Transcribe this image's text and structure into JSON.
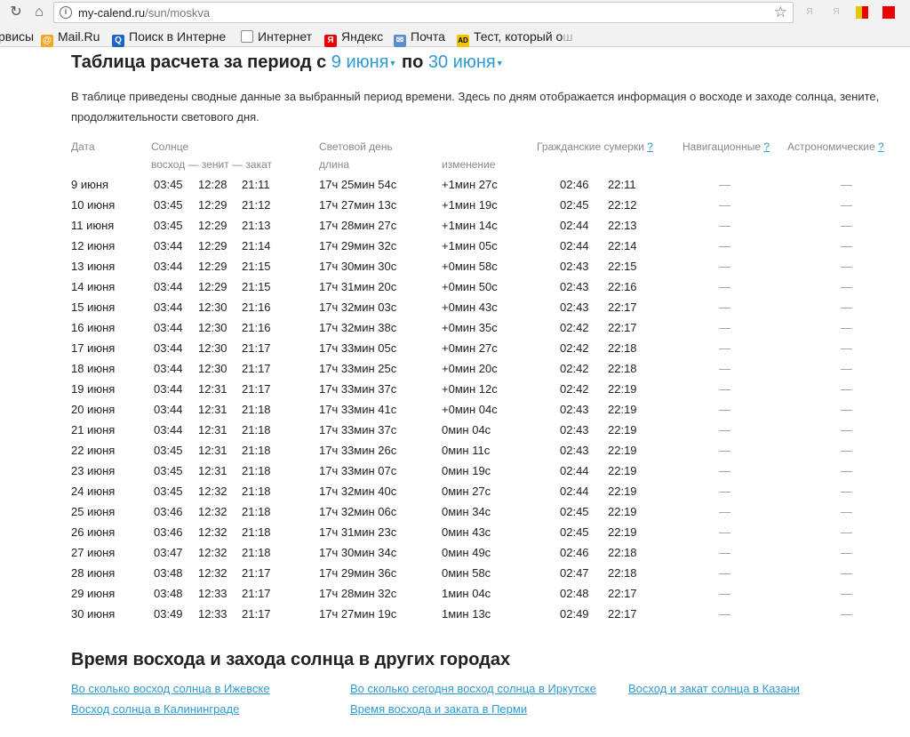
{
  "browser": {
    "url_host": "my-calend.ru",
    "url_path": "/sun/moskva",
    "ext_1": "Я",
    "ext_2": "Я"
  },
  "bookmarks": [
    {
      "label": "рвисы",
      "icon": "none"
    },
    {
      "label": "Mail.Ru",
      "icon": "mailru-icon"
    },
    {
      "label": "Поиск в Интерне",
      "icon": "search-icon"
    },
    {
      "label": "Интернет",
      "icon": "page-icon"
    },
    {
      "label": "Яндекс",
      "icon": "yandex-icon"
    },
    {
      "label": "Почта",
      "icon": "mail-icon"
    },
    {
      "label": "Тест, который о",
      "icon": "ad-icon",
      "fade": "ш"
    }
  ],
  "page": {
    "title_prefix": "Таблица расчета за период с",
    "date_from": "9 июня",
    "title_middle": "по",
    "date_to": "30 июня",
    "lead": "В таблице приведены сводные данные за выбранный период времени. Здесь по дням отображается информация о восходе и заходе солнца, зените, продолжительности светового дня.",
    "headers": {
      "date": "Дата",
      "sun": "Солнце",
      "sun_sub": "восход — зенит — закат",
      "daylight": "Световой день",
      "length": "длина",
      "change": "изменение",
      "civil": "Гражданские сумерки",
      "nautical": "Навигационные",
      "astro": "Астрономические",
      "q": "?"
    },
    "rows": [
      [
        "9 июня",
        "03:45",
        "12:28",
        "21:11",
        "17ч 25мин 54с",
        "+1мин 27с",
        "02:46",
        "22:11",
        "—",
        "—"
      ],
      [
        "10 июня",
        "03:45",
        "12:29",
        "21:12",
        "17ч 27мин 13с",
        "+1мин 19с",
        "02:45",
        "22:12",
        "—",
        "—"
      ],
      [
        "11 июня",
        "03:45",
        "12:29",
        "21:13",
        "17ч 28мин 27с",
        "+1мин 14с",
        "02:44",
        "22:13",
        "—",
        "—"
      ],
      [
        "12 июня",
        "03:44",
        "12:29",
        "21:14",
        "17ч 29мин 32с",
        "+1мин 05с",
        "02:44",
        "22:14",
        "—",
        "—"
      ],
      [
        "13 июня",
        "03:44",
        "12:29",
        "21:15",
        "17ч 30мин 30с",
        "+0мин 58с",
        "02:43",
        "22:15",
        "—",
        "—"
      ],
      [
        "14 июня",
        "03:44",
        "12:29",
        "21:15",
        "17ч 31мин 20с",
        "+0мин 50с",
        "02:43",
        "22:16",
        "—",
        "—"
      ],
      [
        "15 июня",
        "03:44",
        "12:30",
        "21:16",
        "17ч 32мин 03с",
        "+0мин 43с",
        "02:43",
        "22:17",
        "—",
        "—"
      ],
      [
        "16 июня",
        "03:44",
        "12:30",
        "21:16",
        "17ч 32мин 38с",
        "+0мин 35с",
        "02:42",
        "22:17",
        "—",
        "—"
      ],
      [
        "17 июня",
        "03:44",
        "12:30",
        "21:17",
        "17ч 33мин 05с",
        "+0мин 27с",
        "02:42",
        "22:18",
        "—",
        "—"
      ],
      [
        "18 июня",
        "03:44",
        "12:30",
        "21:17",
        "17ч 33мин 25с",
        "+0мин 20с",
        "02:42",
        "22:18",
        "—",
        "—"
      ],
      [
        "19 июня",
        "03:44",
        "12:31",
        "21:17",
        "17ч 33мин 37с",
        "+0мин 12с",
        "02:42",
        "22:19",
        "—",
        "—"
      ],
      [
        "20 июня",
        "03:44",
        "12:31",
        "21:18",
        "17ч 33мин 41с",
        "+0мин 04с",
        "02:43",
        "22:19",
        "—",
        "—"
      ],
      [
        "21 июня",
        "03:44",
        "12:31",
        "21:18",
        "17ч 33мин 37с",
        "0мин 04с",
        "02:43",
        "22:19",
        "—",
        "—"
      ],
      [
        "22 июня",
        "03:45",
        "12:31",
        "21:18",
        "17ч 33мин 26с",
        "0мин 11с",
        "02:43",
        "22:19",
        "—",
        "—"
      ],
      [
        "23 июня",
        "03:45",
        "12:31",
        "21:18",
        "17ч 33мин 07с",
        "0мин 19с",
        "02:44",
        "22:19",
        "—",
        "—"
      ],
      [
        "24 июня",
        "03:45",
        "12:32",
        "21:18",
        "17ч 32мин 40с",
        "0мин 27с",
        "02:44",
        "22:19",
        "—",
        "—"
      ],
      [
        "25 июня",
        "03:46",
        "12:32",
        "21:18",
        "17ч 32мин 06с",
        "0мин 34с",
        "02:45",
        "22:19",
        "—",
        "—"
      ],
      [
        "26 июня",
        "03:46",
        "12:32",
        "21:18",
        "17ч 31мин 23с",
        "0мин 43с",
        "02:45",
        "22:19",
        "—",
        "—"
      ],
      [
        "27 июня",
        "03:47",
        "12:32",
        "21:18",
        "17ч 30мин 34с",
        "0мин 49с",
        "02:46",
        "22:18",
        "—",
        "—"
      ],
      [
        "28 июня",
        "03:48",
        "12:32",
        "21:17",
        "17ч 29мин 36с",
        "0мин 58с",
        "02:47",
        "22:18",
        "—",
        "—"
      ],
      [
        "29 июня",
        "03:48",
        "12:33",
        "21:17",
        "17ч 28мин 32с",
        "1мин 04с",
        "02:48",
        "22:17",
        "—",
        "—"
      ],
      [
        "30 июня",
        "03:49",
        "12:33",
        "21:17",
        "17ч 27мин 19с",
        "1мин 13с",
        "02:49",
        "22:17",
        "—",
        "—"
      ]
    ],
    "other_cities_title": "Время восхода и захода солнца в других городах",
    "links": [
      "Во сколько восход солнца в Ижевске",
      "Во сколько сегодня восход солнца в Иркутске",
      "Восход и закат солнца в Казани",
      "Восход солнца в Калининграде",
      "Время восхода и заката в Перми"
    ]
  }
}
